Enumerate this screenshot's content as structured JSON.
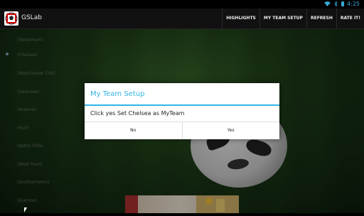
{
  "status_bar": {
    "time": "4:25",
    "icons": [
      "wifi-icon",
      "bluetooth-icon",
      "battery-icon"
    ],
    "accent_color": "#3aa7d8"
  },
  "action_bar": {
    "app_title": "GSLab",
    "menu_items": [
      "HIGHLIGHTS",
      "MY TEAM SETUP",
      "REFRESH",
      "RATE IT!"
    ]
  },
  "team_list": [
    "(Tottenham)",
    "(Chelsea)",
    "(Manchester City)",
    "(Swansea)",
    "(Arsenal)",
    "(Hull)",
    "(Aston Villa)",
    "(West Ham)",
    "(Southampton)",
    "(Everton)"
  ],
  "dialog": {
    "title": "My Team Setup",
    "message": "Click yes Set Chelsea as MyTeam",
    "no_label": "No",
    "yes_label": "Yes",
    "accent_color": "#33b5e5"
  },
  "ad_banner": {
    "icons": [
      "football-player-ad-icon"
    ]
  }
}
